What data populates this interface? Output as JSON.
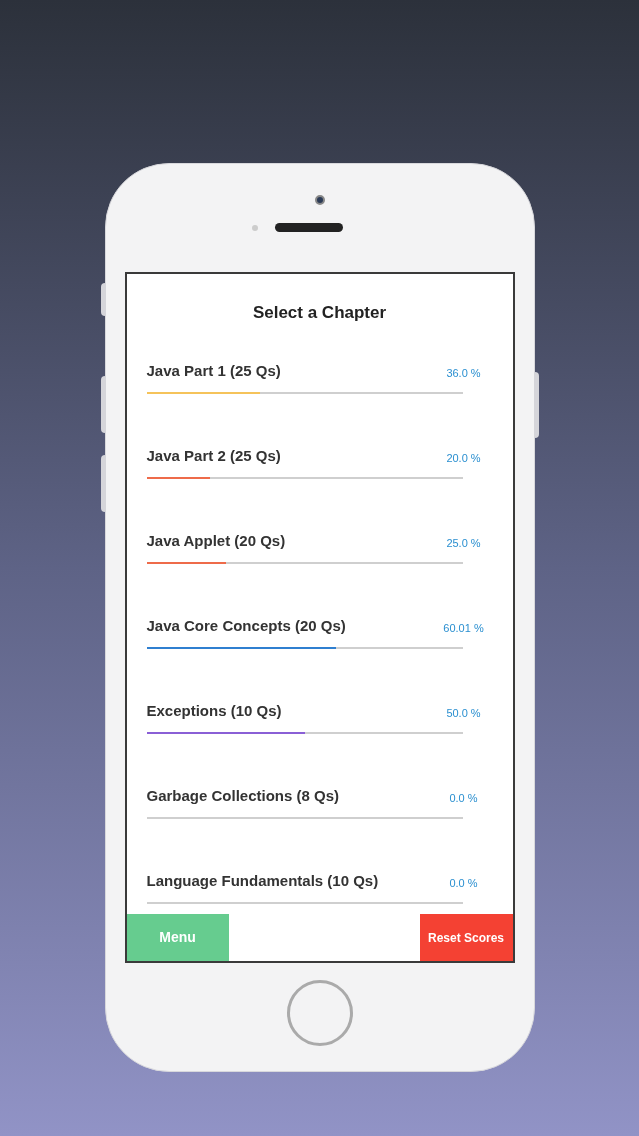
{
  "title": "Select a Chapter",
  "chapters": [
    {
      "label": "Java Part 1 (25 Qs)",
      "percent": "36.0 %",
      "level": 0.36,
      "color": "#f5c35a"
    },
    {
      "label": "Java Part 2 (25 Qs)",
      "percent": "20.0 %",
      "level": 0.2,
      "color": "#ee6b4a"
    },
    {
      "label": "Java Applet (20 Qs)",
      "percent": "25.0 %",
      "level": 0.25,
      "color": "#ee6b4a"
    },
    {
      "label": "Java Core Concepts (20 Qs)",
      "percent": "60.01 %",
      "level": 0.6,
      "color": "#2f7fd0"
    },
    {
      "label": "Exceptions (10 Qs)",
      "percent": "50.0 %",
      "level": 0.5,
      "color": "#8a5fd6"
    },
    {
      "label": "Garbage Collections (8 Qs)",
      "percent": "0.0 %"
    },
    {
      "label": "Language Fundamentals (10 Qs)",
      "percent": "0.0 %"
    }
  ],
  "buttons": {
    "menu": "Menu",
    "reset": "Reset Scores"
  }
}
